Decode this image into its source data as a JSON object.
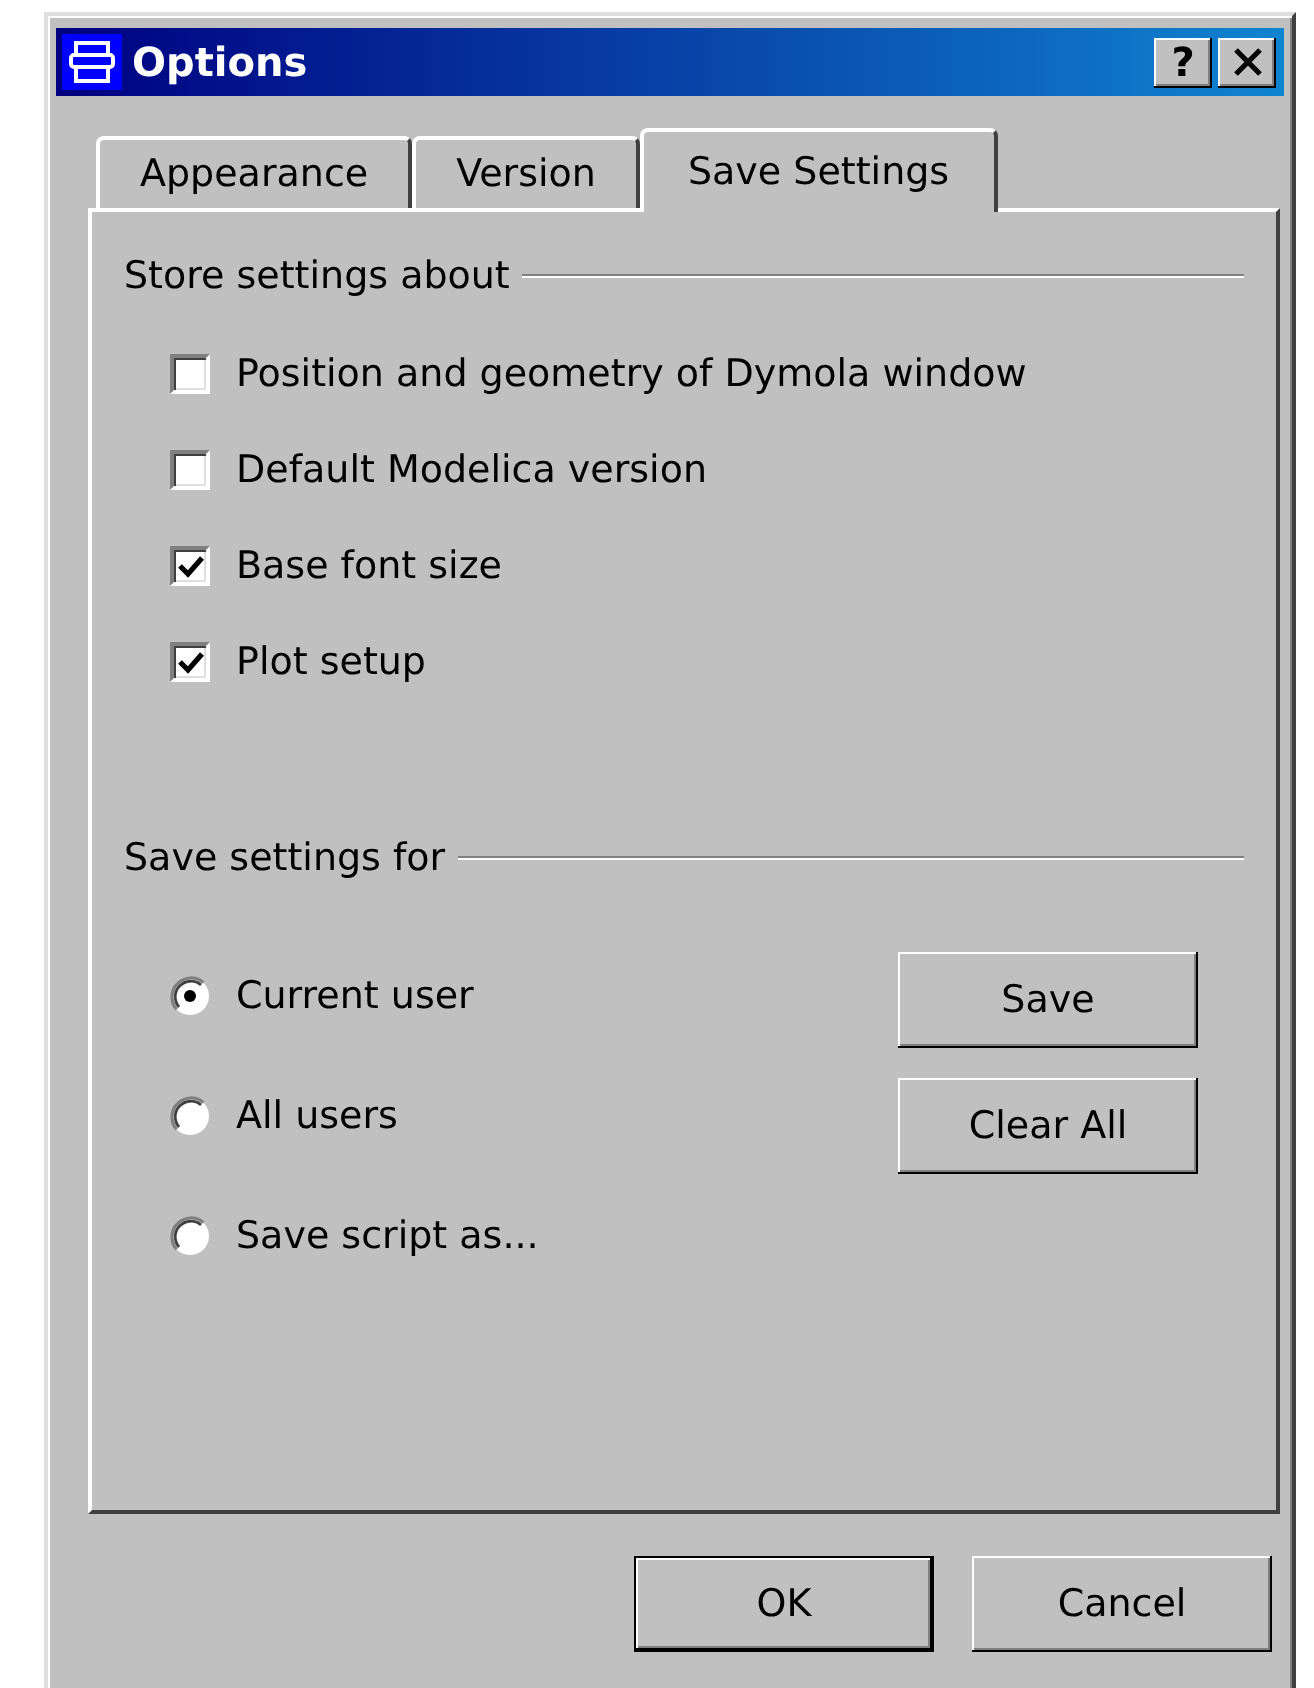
{
  "window": {
    "title": "Options",
    "help_button": "?"
  },
  "tabs": [
    {
      "label": "Appearance",
      "selected": false
    },
    {
      "label": "Version",
      "selected": false
    },
    {
      "label": "Save Settings",
      "selected": true
    }
  ],
  "store_group": {
    "label": "Store settings about",
    "options": [
      {
        "label": "Position and geometry of Dymola window",
        "checked": false
      },
      {
        "label": "Default Modelica version",
        "checked": false
      },
      {
        "label": "Base font size",
        "checked": true
      },
      {
        "label": "Plot setup",
        "checked": true
      }
    ]
  },
  "save_group": {
    "label": "Save settings for",
    "options": [
      {
        "label": "Current user",
        "selected": true
      },
      {
        "label": "All users",
        "selected": false
      },
      {
        "label": "Save script as...",
        "selected": false
      }
    ],
    "buttons": [
      "Save",
      "Clear All"
    ]
  },
  "dialog_buttons": [
    {
      "label": "OK",
      "default": true
    },
    {
      "label": "Cancel",
      "default": false
    }
  ]
}
